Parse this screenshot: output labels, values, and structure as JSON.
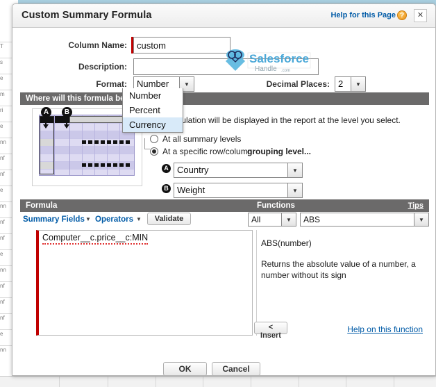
{
  "window": {
    "title": "Custom Summary Formula",
    "help_link": "Help for this Page",
    "help_icon": "?",
    "close_icon": "×"
  },
  "form": {
    "column_name_label": "Column Name:",
    "column_name_value": "custom",
    "description_label": "Description:",
    "description_value": "",
    "format_label": "Format:",
    "format_value": "Number",
    "format_options": [
      "Number",
      "Percent",
      "Currency"
    ],
    "format_selected_option": "Currency",
    "decimal_places_label": "Decimal Places:",
    "decimal_places_value": "2"
  },
  "where_section": {
    "header": "Where will this formula be calculated?",
    "hint": "This calculation will be displayed in the report at the level you select.",
    "hint_visible_part": "calculation will be displayed in the report at the level you select.",
    "radio_all_label": "At all summary levels",
    "radio_specific_prefix": "At a specific row/column ",
    "radio_specific_strong": "grouping level...",
    "radio_selected": "specific",
    "grouping_a_badge": "A",
    "grouping_a_value": "Country",
    "grouping_b_badge": "B",
    "grouping_b_value": "Weight",
    "marker_a": "A",
    "marker_b": "B"
  },
  "formula_section": {
    "header": "Formula",
    "summary_fields_label": "Summary Fields",
    "operators_label": "Operators",
    "validate_label": "Validate",
    "formula_text": "Computer__c.price__c:MIN"
  },
  "functions_section": {
    "header": "Functions",
    "tips_label": "Tips",
    "category_value": "All",
    "function_value": "ABS",
    "signature": "ABS(number)",
    "description": "Returns the absolute value of a number, a number without its sign",
    "insert_label": "< Insert",
    "help_on_function_label": "Help on this function"
  },
  "footer": {
    "ok_label": "OK",
    "cancel_label": "Cancel"
  },
  "watermark": {
    "brand": "Salesforce",
    "sub": "Handle",
    "sub_small": ".com",
    "color": "#4aa8d8"
  },
  "background": {
    "left_lines": [
      "T",
      "s",
      "e",
      "m",
      "ri",
      "e",
      "nn",
      "nf",
      "nf",
      "e",
      "nn",
      "nf",
      "nf",
      "e",
      "nn",
      "nf",
      "nf",
      "nf",
      "e",
      "nn"
    ]
  },
  "colors": {
    "accent_link": "#015ba7",
    "section_bar": "#6b6a6a",
    "required_bar": "#c00000",
    "highlight": "#d8eaf9"
  }
}
